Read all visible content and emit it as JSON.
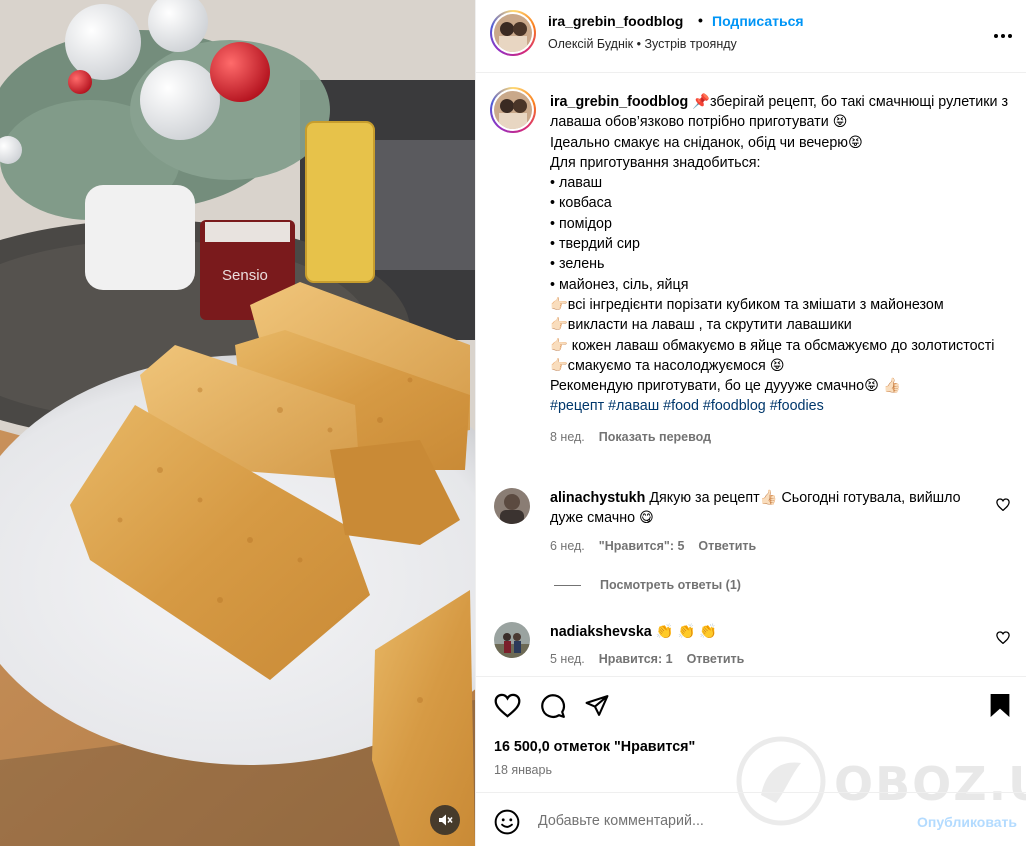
{
  "header": {
    "username": "ira_grebin_foodblog",
    "separator": "•",
    "follow_label": "Подписаться",
    "subtitle": "Олексій Буднік • Зустрів троянду",
    "more_label": "•••"
  },
  "caption": {
    "username": "ira_grebin_foodblog",
    "lines": [
      "📌зберігай рецепт, бо такі смачнющі рулетики з лаваша обов’язково потрібно приготувати 😝",
      "Ідеально смакує на сніданок, обід чи вечерю😝",
      "Для приготування знадобиться:",
      "• лаваш",
      "• ковбаса",
      "• помідор",
      "• твердий сир",
      "• зелень",
      "• майонез, сіль, яйця",
      "👉🏻всі інгредієнти порізати кубиком та змішати з майонезом",
      "👉🏻викласти на лаваш , та скрутити лавашики",
      "👉🏻 кожен лаваш обмакуємо в яйце та обсмажуємо до золотистості",
      "👉🏻смакуємо та насолоджуємося 😝",
      "Рекомендую приготувати, бо це дуууже смачно😝 👍🏻"
    ],
    "hashtags": "#рецепт #лаваш #food #foodblog #foodies",
    "age": "8 нед.",
    "translate_label": "Показать перевод"
  },
  "comments": [
    {
      "username": "alinachystukh",
      "text": "Дякую за рецепт👍🏻 Сьогодні готувала, вийшло дуже смачно 😋",
      "age": "6 нед.",
      "likes_label": "\"Нравится\": 5",
      "reply_label": "Ответить",
      "view_replies": "Посмотреть ответы (1)"
    },
    {
      "username": "nadiakshevska",
      "text": "👏 👏 👏",
      "age": "5 нед.",
      "likes_label": "Нравится: 1",
      "reply_label": "Ответить"
    }
  ],
  "actions": {
    "likes_count": "16 500,0 отметок \"Нравится\"",
    "date": "18 январь"
  },
  "add_comment": {
    "placeholder": "Добавьте комментарий...",
    "publish_label": "Опубликовать"
  },
  "watermark_text": "OBOZ.UA",
  "media": {
    "candle_label": "Sensio"
  },
  "colors": {
    "link_blue": "#0095f6",
    "hashtag_blue": "#00376b",
    "muted_gray": "#737373",
    "publish_disabled": "#b3dbff"
  }
}
